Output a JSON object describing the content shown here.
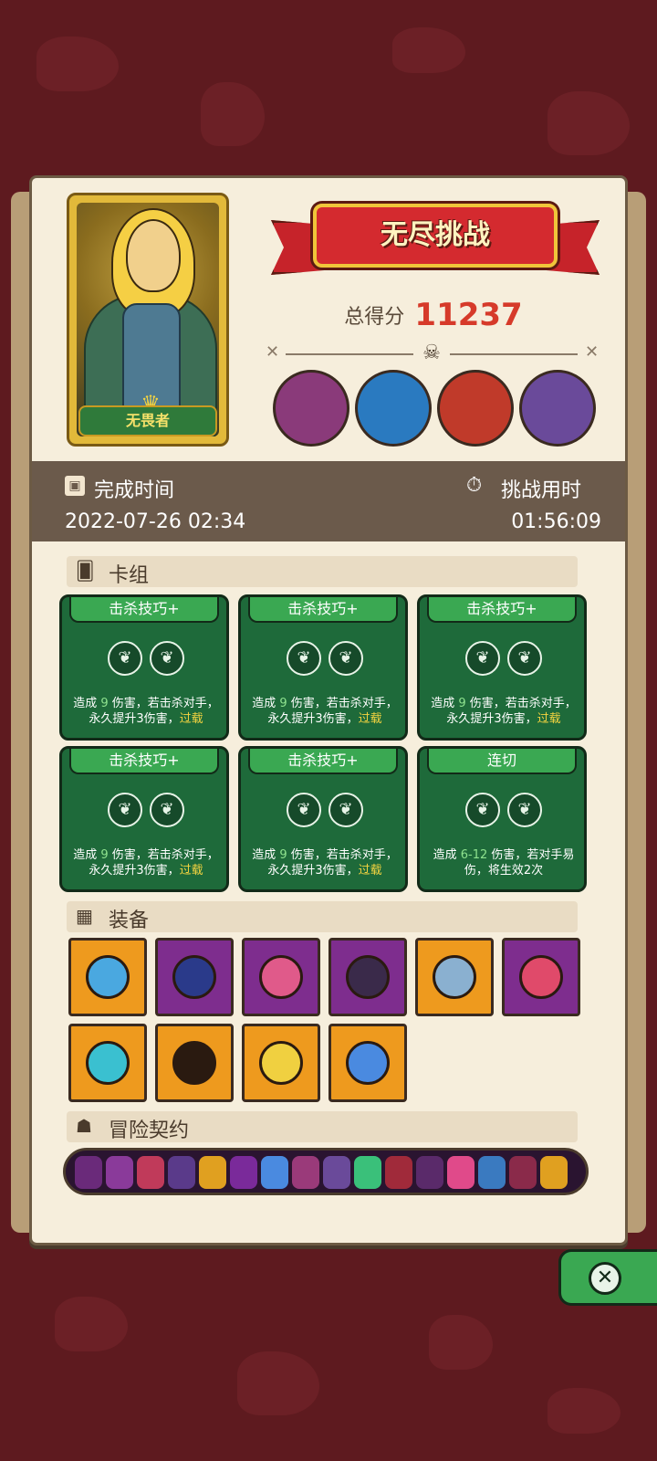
{
  "header": {
    "title": "无尽挑战",
    "score_label": "总得分",
    "score_value": "11237"
  },
  "hero": {
    "name": "无畏者"
  },
  "bosses": [
    {
      "icon": "stone-golem-boss-icon",
      "color": "#8a3a7a"
    },
    {
      "icon": "masked-shaman-boss-icon",
      "color": "#2a7ac0"
    },
    {
      "icon": "fire-demon-boss-icon",
      "color": "#c03a2a"
    },
    {
      "icon": "purple-dragon-boss-icon",
      "color": "#6a4a9a"
    }
  ],
  "time": {
    "completion_label": "完成时间",
    "completion_value": "2022-07-26 02:34",
    "duration_label": "挑战用时",
    "duration_value": "01:56:09"
  },
  "sections": {
    "deck": "卡组",
    "equipment": "装备",
    "contract": "冒险契约"
  },
  "cards": [
    {
      "title": "击杀技巧+",
      "cost": "2",
      "desc_a": "造成 ",
      "num": "9",
      "desc_b": " 伤害，若击杀对手，永久提升3伤害，",
      "keyword": "过载"
    },
    {
      "title": "击杀技巧+",
      "cost": "2",
      "desc_a": "造成 ",
      "num": "9",
      "desc_b": " 伤害，若击杀对手，永久提升3伤害，",
      "keyword": "过载"
    },
    {
      "title": "击杀技巧+",
      "cost": "2",
      "desc_a": "造成 ",
      "num": "9",
      "desc_b": " 伤害，若击杀对手，永久提升3伤害，",
      "keyword": "过载"
    },
    {
      "title": "击杀技巧+",
      "cost": "2",
      "desc_a": "造成 ",
      "num": "9",
      "desc_b": " 伤害，若击杀对手，永久提升3伤害，",
      "keyword": "过载"
    },
    {
      "title": "击杀技巧+",
      "cost": "2",
      "desc_a": "造成 ",
      "num": "9",
      "desc_b": " 伤害，若击杀对手，永久提升3伤害，",
      "keyword": "过载"
    },
    {
      "title": "连切",
      "cost": "2",
      "desc_a": "造成 ",
      "num": "6-12",
      "desc_b": " 伤害，若对手易伤，将生效2次",
      "keyword": ""
    }
  ],
  "equipment": [
    {
      "icon": "blue-shield-icon",
      "rarity": "orange",
      "color": "#4aa8e0"
    },
    {
      "icon": "horned-helmet-icon",
      "rarity": "purple",
      "color": "#2a3a8a"
    },
    {
      "icon": "mushroom-cap-icon",
      "rarity": "purple",
      "color": "#e05a8a"
    },
    {
      "icon": "dark-armor-icon",
      "rarity": "purple",
      "color": "#3a2a4a"
    },
    {
      "icon": "war-horn-icon",
      "rarity": "orange",
      "color": "#8ab0d0"
    },
    {
      "icon": "crimson-cloak-icon",
      "rarity": "purple",
      "color": "#e04a6a"
    },
    {
      "icon": "flame-crest-icon",
      "rarity": "orange",
      "color": "#3ac0d0"
    },
    {
      "icon": "shadow-mask-icon",
      "rarity": "orange",
      "color": "#2a1a10"
    },
    {
      "icon": "gold-crown-icon",
      "rarity": "orange",
      "color": "#f0d040"
    },
    {
      "icon": "blue-slime-icon",
      "rarity": "orange",
      "color": "#4a8ae0"
    }
  ],
  "colors": {
    "background": "#5e1a1f",
    "panel": "#f6eedc",
    "card_green": "#1e6a3a",
    "score_red": "#d63a2a"
  }
}
